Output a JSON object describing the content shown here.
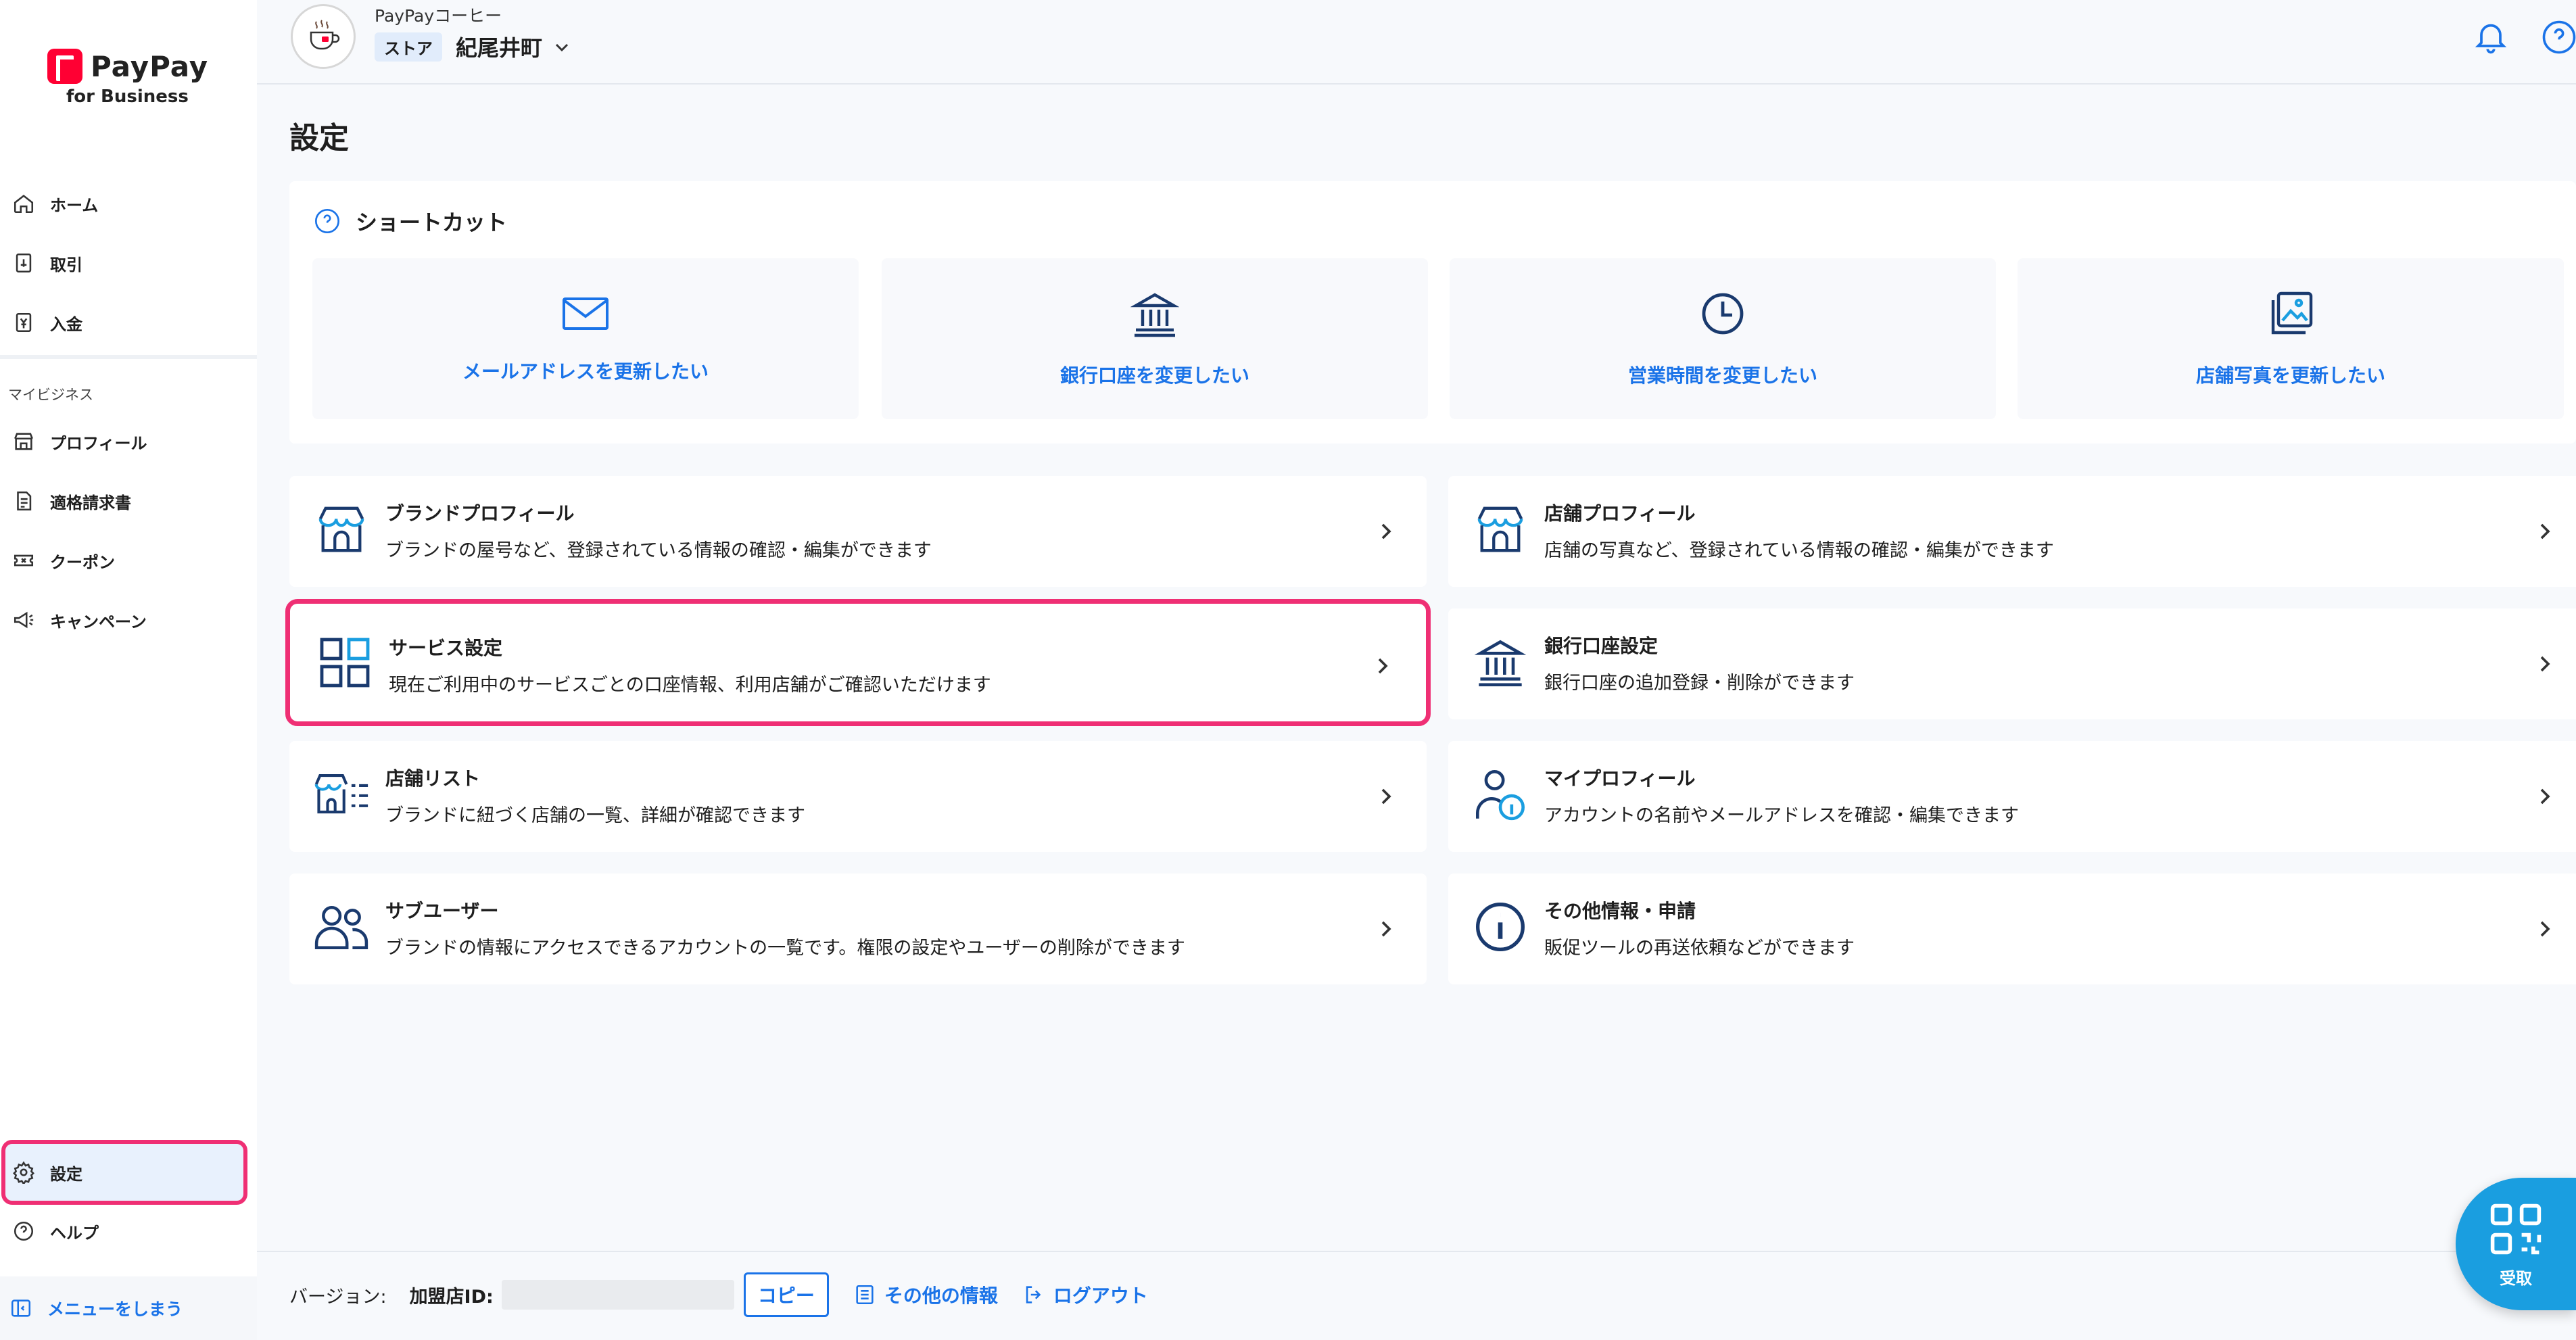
{
  "brand": {
    "name": "PayPay",
    "sub": "for Business",
    "color": "#ff0033"
  },
  "sidebar": {
    "items": [
      {
        "label": "ホーム",
        "icon": "home-icon"
      },
      {
        "label": "取引",
        "icon": "receipt-icon"
      },
      {
        "label": "入金",
        "icon": "yen-icon"
      }
    ],
    "section_label": "マイビジネス",
    "business_items": [
      {
        "label": "プロフィール",
        "icon": "store-icon"
      },
      {
        "label": "適格請求書",
        "icon": "invoice-icon"
      },
      {
        "label": "クーポン",
        "icon": "coupon-icon"
      },
      {
        "label": "キャンペーン",
        "icon": "megaphone-icon"
      }
    ],
    "settings_label": "設定",
    "help_label": "ヘルプ",
    "collapse_label": "メニューをしまう"
  },
  "header": {
    "merchant_name": "PayPayコーヒー",
    "store_badge": "ストア",
    "store_name": "紀尾井町"
  },
  "page": {
    "title": "設定"
  },
  "shortcuts": {
    "title": "ショートカット",
    "items": [
      {
        "label": "メールアドレスを更新したい",
        "icon": "mail-icon"
      },
      {
        "label": "銀行口座を変更したい",
        "icon": "bank-icon"
      },
      {
        "label": "営業時間を変更したい",
        "icon": "clock-icon"
      },
      {
        "label": "店舗写真を更新したい",
        "icon": "photos-icon"
      }
    ]
  },
  "settings": [
    {
      "title": "ブランドプロフィール",
      "desc": "ブランドの屋号など、登録されている情報の確認・編集ができます",
      "icon": "store-icon"
    },
    {
      "title": "店舗プロフィール",
      "desc": "店舗の写真など、登録されている情報の確認・編集ができます",
      "icon": "store-icon"
    },
    {
      "title": "サービス設定",
      "desc": "現在ご利用中のサービスごとの口座情報、利用店舗がご確認いただけます",
      "icon": "grid-icon"
    },
    {
      "title": "銀行口座設定",
      "desc": "銀行口座の追加登録・削除ができます",
      "icon": "bank-icon"
    },
    {
      "title": "店舗リスト",
      "desc": "ブランドに紐づく店舗の一覧、詳細が確認できます",
      "icon": "store-list-icon"
    },
    {
      "title": "マイプロフィール",
      "desc": "アカウントの名前やメールアドレスを確認・編集できます",
      "icon": "user-info-icon"
    },
    {
      "title": "サブユーザー",
      "desc": "ブランドの情報にアクセスできるアカウントの一覧です。権限の設定やユーザーの削除ができます",
      "icon": "users-icon"
    },
    {
      "title": "その他情報・申請",
      "desc": "販促ツールの再送依頼などができます",
      "icon": "info-icon"
    }
  ],
  "footer": {
    "version_label": "バージョン:",
    "merchant_id_label": "加盟店ID:",
    "copy_label": "コピー",
    "other_info_label": "その他の情報",
    "logout_label": "ログアウト"
  },
  "fab": {
    "label": "受取"
  },
  "colors": {
    "accent": "#1a73e8",
    "highlight": "#ef2f74",
    "fab": "#1a9ee0"
  }
}
